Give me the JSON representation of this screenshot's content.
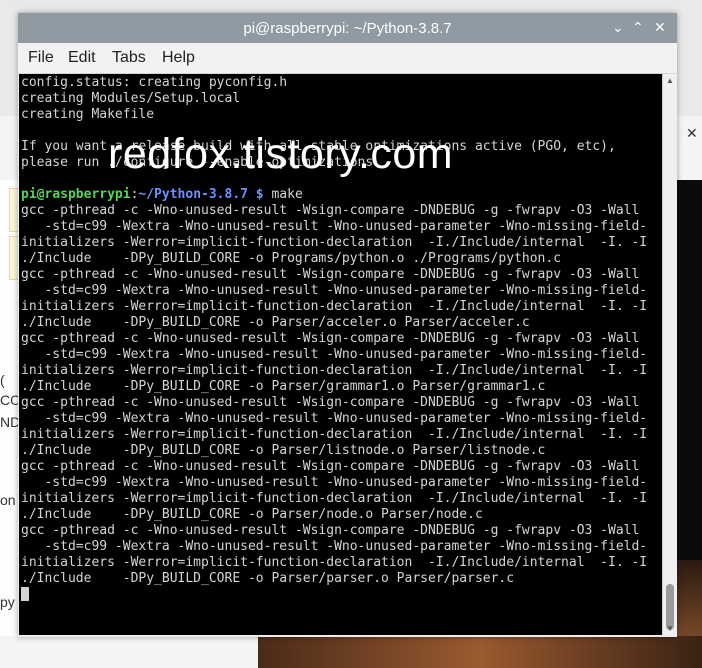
{
  "window": {
    "title": "pi@raspberrypi: ~/Python-3.8.7",
    "controls": {
      "minimize": "⌄",
      "maximize": "⌃",
      "close": "✕"
    }
  },
  "menu": [
    "File",
    "Edit",
    "Tabs",
    "Help"
  ],
  "background": {
    "close": "✕",
    "fragments": [
      "(",
      "CO",
      "ND",
      "on",
      "py"
    ]
  },
  "watermark": "redfox.tistory.com",
  "terminal": {
    "pre_lines": [
      "config.status: creating pyconfig.h",
      "creating Modules/Setup.local",
      "creating Makefile",
      "",
      "If you want a release build with all stable optimizations active (PGO, etc),",
      "please run ./configure --enable-optimizations",
      ""
    ],
    "prompt": {
      "user": "pi@raspberrypi",
      "sep": ":",
      "path": "~/Python-3.8.7 $",
      "command": " make"
    },
    "post_lines": [
      "gcc -pthread -c -Wno-unused-result -Wsign-compare -DNDEBUG -g -fwrapv -O3 -Wall",
      "   -std=c99 -Wextra -Wno-unused-result -Wno-unused-parameter -Wno-missing-field-",
      "initializers -Werror=implicit-function-declaration  -I./Include/internal  -I. -I",
      "./Include    -DPy_BUILD_CORE -o Programs/python.o ./Programs/python.c",
      "gcc -pthread -c -Wno-unused-result -Wsign-compare -DNDEBUG -g -fwrapv -O3 -Wall",
      "   -std=c99 -Wextra -Wno-unused-result -Wno-unused-parameter -Wno-missing-field-",
      "initializers -Werror=implicit-function-declaration  -I./Include/internal  -I. -I",
      "./Include    -DPy_BUILD_CORE -o Parser/acceler.o Parser/acceler.c",
      "gcc -pthread -c -Wno-unused-result -Wsign-compare -DNDEBUG -g -fwrapv -O3 -Wall",
      "   -std=c99 -Wextra -Wno-unused-result -Wno-unused-parameter -Wno-missing-field-",
      "initializers -Werror=implicit-function-declaration  -I./Include/internal  -I. -I",
      "./Include    -DPy_BUILD_CORE -o Parser/grammar1.o Parser/grammar1.c",
      "gcc -pthread -c -Wno-unused-result -Wsign-compare -DNDEBUG -g -fwrapv -O3 -Wall",
      "   -std=c99 -Wextra -Wno-unused-result -Wno-unused-parameter -Wno-missing-field-",
      "initializers -Werror=implicit-function-declaration  -I./Include/internal  -I. -I",
      "./Include    -DPy_BUILD_CORE -o Parser/listnode.o Parser/listnode.c",
      "gcc -pthread -c -Wno-unused-result -Wsign-compare -DNDEBUG -g -fwrapv -O3 -Wall",
      "   -std=c99 -Wextra -Wno-unused-result -Wno-unused-parameter -Wno-missing-field-",
      "initializers -Werror=implicit-function-declaration  -I./Include/internal  -I. -I",
      "./Include    -DPy_BUILD_CORE -o Parser/node.o Parser/node.c",
      "gcc -pthread -c -Wno-unused-result -Wsign-compare -DNDEBUG -g -fwrapv -O3 -Wall",
      "   -std=c99 -Wextra -Wno-unused-result -Wno-unused-parameter -Wno-missing-field-",
      "initializers -Werror=implicit-function-declaration  -I./Include/internal  -I. -I",
      "./Include    -DPy_BUILD_CORE -o Parser/parser.o Parser/parser.c"
    ]
  },
  "colors": {
    "titlebar": "#8f9aa3",
    "terminal_bg": "#000000",
    "terminal_fg": "#d4d4d4",
    "prompt_user": "#56d35a",
    "prompt_path": "#6f8fff"
  },
  "icons": {
    "minimize": "minimize-icon",
    "maximize": "maximize-icon",
    "close": "close-icon"
  }
}
